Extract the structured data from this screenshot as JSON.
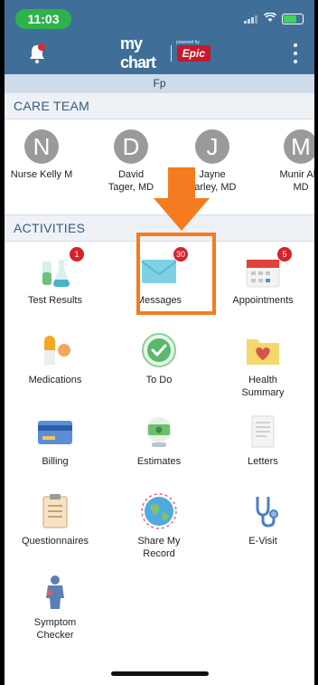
{
  "status": {
    "time": "11:03"
  },
  "header": {
    "logo_my": "my chart",
    "logo_powered": "powered by",
    "logo_epic": "Epic"
  },
  "patient": {
    "name": "Fp"
  },
  "care_team": {
    "title": "CARE TEAM",
    "members": [
      {
        "initial": "N",
        "name_line1": "Nurse Kelly M",
        "name_line2": ""
      },
      {
        "initial": "D",
        "name_line1": "David",
        "name_line2": "Tager, MD"
      },
      {
        "initial": "J",
        "name_line1": "Jayne",
        "name_line2": "Farley, MD"
      },
      {
        "initial": "M",
        "name_line1": "Munir Ahr",
        "name_line2": "MD"
      }
    ]
  },
  "activities": {
    "title": "ACTIVITIES",
    "items": [
      {
        "label_1": "Test Results",
        "label_2": "",
        "badge": "1",
        "icon": "test-tubes-icon"
      },
      {
        "label_1": "Messages",
        "label_2": "",
        "badge": "30",
        "icon": "envelope-icon"
      },
      {
        "label_1": "Appointments",
        "label_2": "",
        "badge": "5",
        "icon": "calendar-icon"
      },
      {
        "label_1": "Medications",
        "label_2": "",
        "badge": "",
        "icon": "pill-icon"
      },
      {
        "label_1": "To Do",
        "label_2": "",
        "badge": "",
        "icon": "checkmark-icon"
      },
      {
        "label_1": "Health",
        "label_2": "Summary",
        "badge": "",
        "icon": "heart-folder-icon"
      },
      {
        "label_1": "Billing",
        "label_2": "",
        "badge": "",
        "icon": "credit-card-icon"
      },
      {
        "label_1": "Estimates",
        "label_2": "",
        "badge": "",
        "icon": "money-globe-icon"
      },
      {
        "label_1": "Letters",
        "label_2": "",
        "badge": "",
        "icon": "letter-icon"
      },
      {
        "label_1": "Questionnaires",
        "label_2": "",
        "badge": "",
        "icon": "clipboard-icon"
      },
      {
        "label_1": "Share My",
        "label_2": "Record",
        "badge": "",
        "icon": "share-globe-icon"
      },
      {
        "label_1": "E-Visit",
        "label_2": "",
        "badge": "",
        "icon": "stethoscope-icon"
      },
      {
        "label_1": "Symptom",
        "label_2": "Checker",
        "badge": "",
        "icon": "body-icon"
      }
    ]
  },
  "colors": {
    "header": "#3f6f98",
    "highlight": "#f47b20",
    "badge": "#d8232a",
    "time_pill": "#2db34a"
  }
}
